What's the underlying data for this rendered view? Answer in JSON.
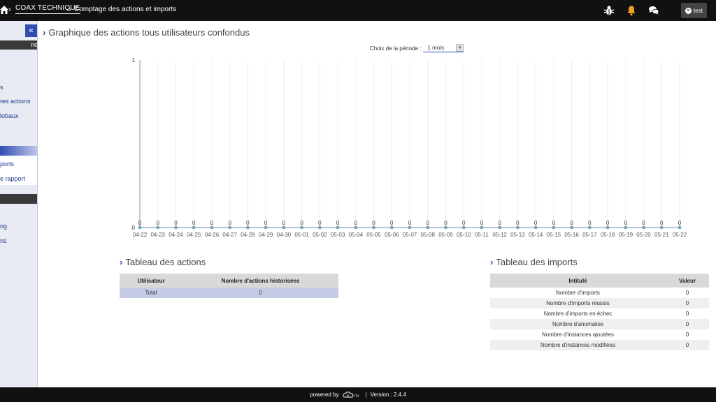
{
  "topbar": {
    "app_name": "COAX TECHNIQUE",
    "page_name": "Comptage des actions et imports",
    "user_label": "test"
  },
  "sidebar": {
    "band1": "no",
    "items_a": [
      "s",
      "res actions",
      "lobaux"
    ],
    "items_b": [
      "ports",
      "e rapport"
    ],
    "items_c": [
      "og",
      "ns"
    ]
  },
  "chart_section": {
    "title": "Graphique des actions tous utilisateurs confondus",
    "period_label": "Choix de la période :",
    "period_value": "1 mois"
  },
  "chart_data": {
    "type": "line",
    "categories": [
      "04-22",
      "04-23",
      "04-24",
      "04-25",
      "04-26",
      "04-27",
      "04-28",
      "04-29",
      "04-30",
      "05-01",
      "05-02",
      "05-03",
      "05-04",
      "05-05",
      "05-06",
      "05-07",
      "05-08",
      "05-09",
      "05-10",
      "05-11",
      "05-12",
      "05-13",
      "05-14",
      "05-15",
      "05-16",
      "05-17",
      "05-18",
      "05-19",
      "05-20",
      "05-21",
      "05-22"
    ],
    "values": [
      0,
      0,
      0,
      0,
      0,
      0,
      0,
      0,
      0,
      0,
      0,
      0,
      0,
      0,
      0,
      0,
      0,
      0,
      0,
      0,
      0,
      0,
      0,
      0,
      0,
      0,
      0,
      0,
      0,
      0,
      0
    ],
    "ylim": [
      0,
      1
    ],
    "yticks": [
      "0",
      "1"
    ],
    "grid": true,
    "color": "#7aa6b8"
  },
  "actions_table": {
    "title": "Tableau des actions",
    "headers": [
      "Utilisateur",
      "Nombre d'actions historisées"
    ],
    "rows": [
      [
        "Total",
        "0"
      ]
    ]
  },
  "imports_table": {
    "title": "Tableau des imports",
    "headers": [
      "Intitulé",
      "Valeur"
    ],
    "rows": [
      [
        "Nombre d'imports",
        "0"
      ],
      [
        "Nombre d'imports réussis",
        "0"
      ],
      [
        "Nombre d'imports en échec",
        "0"
      ],
      [
        "Nombre d'anomalies",
        "0"
      ],
      [
        "Nombre d'instances ajoutées",
        "0"
      ],
      [
        "Nombre d'instances modifiées",
        "0"
      ]
    ]
  },
  "footer": {
    "powered_by": "powered by",
    "separator": "|",
    "version": "Version : 2.4.4"
  },
  "colors": {
    "accent": "#2f4eb0",
    "topbar": "#111111",
    "bell": "#f0a020"
  }
}
